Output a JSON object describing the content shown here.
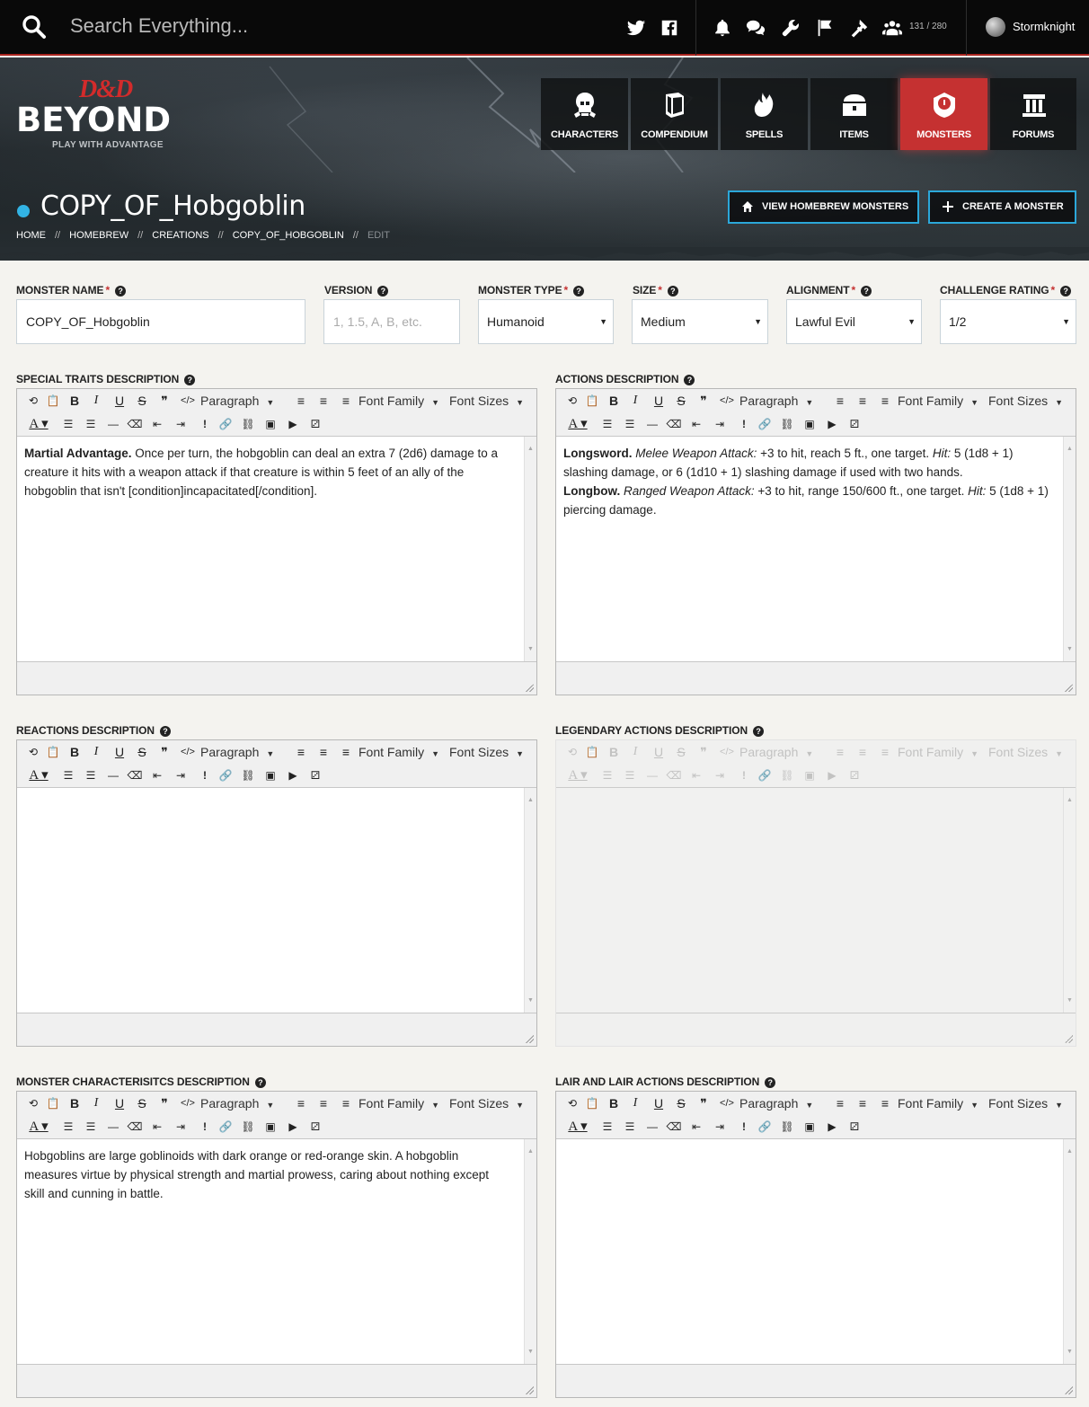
{
  "topbar": {
    "search_placeholder": "Search Everything...",
    "social_icons": [
      "twitter-icon",
      "facebook-icon"
    ],
    "action_icons": [
      "bell-icon",
      "chat-icon",
      "wrench-icon",
      "flag-icon",
      "hammer-icon",
      "group-icon"
    ],
    "friends_count": "131 / 280",
    "username": "Stormknight"
  },
  "logo": {
    "mark": "D&D",
    "wordmark": "BEYOND",
    "tagline": "PLAY WITH ADVANTAGE"
  },
  "nav": {
    "items": [
      {
        "label": "CHARACTERS",
        "icon": "skull-helm-icon",
        "active": false
      },
      {
        "label": "COMPENDIUM",
        "icon": "book-icon",
        "active": false
      },
      {
        "label": "SPELLS",
        "icon": "hand-flame-icon",
        "active": false
      },
      {
        "label": "ITEMS",
        "icon": "chest-icon",
        "active": false
      },
      {
        "label": "MONSTERS",
        "icon": "monster-shield-icon",
        "active": true
      },
      {
        "label": "FORUMS",
        "icon": "pillar-icon",
        "active": false
      }
    ]
  },
  "page": {
    "title": "COPY_OF_Hobgoblin",
    "breadcrumb": [
      "HOME",
      "HOMEBREW",
      "CREATIONS",
      "COPY_OF_HOBGOBLIN",
      "EDIT"
    ],
    "breadcrumb_sep": "//",
    "buttons": {
      "view_homebrew": "VIEW HOMEBREW MONSTERS",
      "create": "CREATE A MONSTER"
    }
  },
  "fields": {
    "monster_name": {
      "label": "MONSTER NAME",
      "required": "*",
      "value": "COPY_OF_Hobgoblin"
    },
    "version": {
      "label": "VERSION",
      "placeholder": "1, 1.5, A, B, etc."
    },
    "monster_type": {
      "label": "MONSTER TYPE",
      "required": "*",
      "value": "Humanoid"
    },
    "size": {
      "label": "SIZE",
      "required": "*",
      "value": "Medium"
    },
    "alignment": {
      "label": "ALIGNMENT",
      "required": "*",
      "value": "Lawful Evil"
    },
    "challenge_rating": {
      "label": "CHALLENGE RATING",
      "required": "*",
      "value": "1/2"
    }
  },
  "toolbar": {
    "paragraph": "Paragraph",
    "font_family": "Font Family",
    "font_sizes": "Font Sizes"
  },
  "editors": {
    "special_traits": {
      "label": "SPECIAL TRAITS DESCRIPTION",
      "p1_bold": "Martial Advantage.",
      "p1_text": " Once per turn, the hobgoblin can deal an extra 7 (2d6) damage to a creature it hits with a weapon attack if that creature is within 5 feet of an ally of the hobgoblin that isn't [condition]incapacitated[/condition]."
    },
    "actions": {
      "label": "ACTIONS DESCRIPTION",
      "l1_bold": "Longsword.",
      "l1_italic": "Melee Weapon Attack:",
      "l1_text": " +3 to hit, reach 5 ft., one target. ",
      "l1_hit": "Hit:",
      "l1_text2": " 5 (1d8 + 1) slashing damage, or 6 (1d10 + 1) slashing damage if used with two hands.",
      "l2_bold": "Longbow.",
      "l2_italic": "Ranged Weapon Attack:",
      "l2_text": " +3 to hit, range 150/600 ft., one target. ",
      "l2_hit": "Hit:",
      "l2_text2": " 5 (1d8 + 1) piercing damage."
    },
    "reactions": {
      "label": "REACTIONS DESCRIPTION"
    },
    "legendary": {
      "label": "LEGENDARY ACTIONS DESCRIPTION"
    },
    "characteristics": {
      "label": "MONSTER CHARACTERISITCS DESCRIPTION",
      "text": "Hobgoblins are large goblinoids with dark orange or red-orange skin. A hobgoblin measures virtue by physical strength and martial prowess, caring about nothing except skill and cunning in battle."
    },
    "lair": {
      "label": "LAIR AND LAIR ACTIONS DESCRIPTION"
    }
  },
  "colors": {
    "accent_red": "#c53131",
    "accent_blue": "#2ba7d9",
    "topbar": "#090909"
  }
}
